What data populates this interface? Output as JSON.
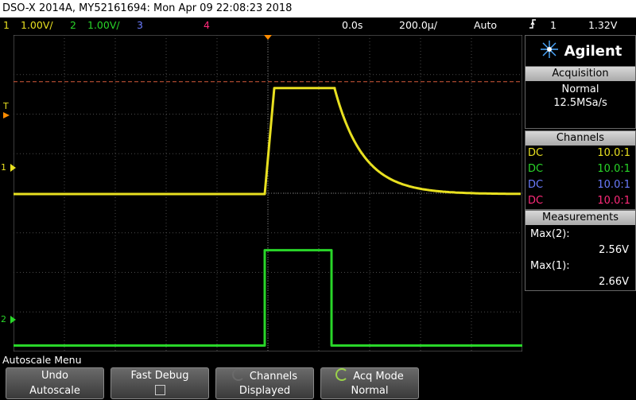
{
  "window": {
    "title": "DSO-X 2014A, MY52161694: Mon Apr 09 22:08:23 2018"
  },
  "status": {
    "ch1_num": "1",
    "ch1_scale": "1.00V/",
    "ch2_num": "2",
    "ch2_scale": "1.00V/",
    "ch3_num": "3",
    "ch4_num": "4",
    "time_delay": "0.0s",
    "time_scale": "200.0µ/",
    "trigger_mode": "Auto",
    "trigger_slope_glyph": "⌁",
    "trigger_source": "1",
    "trigger_level": "1.32V"
  },
  "colors": {
    "ch1": "#e8e020",
    "ch2": "#29d629",
    "ch3": "#6b7cff",
    "ch4": "#ff2a7a",
    "grid": "#4a4a4a",
    "trigger_line": "#d65a3a",
    "trigger_marker": "#ff8c00"
  },
  "brand": {
    "name": "Agilent",
    "logo_icon": "agilent-spark-icon"
  },
  "acquisition": {
    "title": "Acquisition",
    "mode": "Normal",
    "rate": "12.5MSa/s"
  },
  "channels": {
    "title": "Channels",
    "rows": [
      {
        "coupling": "DC",
        "probe": "10.0:1"
      },
      {
        "coupling": "DC",
        "probe": "10.0:1"
      },
      {
        "coupling": "DC",
        "probe": "10.0:1"
      },
      {
        "coupling": "DC",
        "probe": "10.0:1"
      }
    ]
  },
  "measurements": {
    "title": "Measurements",
    "items": [
      {
        "label": "Max(2):",
        "value": "2.56V"
      },
      {
        "label": "Max(1):",
        "value": "2.66V"
      }
    ]
  },
  "markers": {
    "trigger_t": "T",
    "ch1_ref": "1",
    "ch2_ref": "2"
  },
  "menu": {
    "title": "Autoscale Menu",
    "softkeys": [
      {
        "line1": "Undo",
        "line2": "Autoscale"
      },
      {
        "line1": "Fast Debug",
        "line2": ""
      },
      {
        "line1": "Channels",
        "line2": "Displayed"
      },
      {
        "line1": "Acq Mode",
        "line2": "Normal"
      }
    ]
  },
  "chart_data": {
    "type": "line",
    "x": [
      -0.00016,
      0.0,
      1e-05,
      1e-05,
      0.00042,
      0.00048,
      0.00065,
      0.0008,
      0.001,
      0.0012,
      0.00128
    ],
    "xlim": [
      -0.0016,
      0.0016
    ],
    "ylim": [
      -4,
      4
    ],
    "series": [
      {
        "name": "1",
        "x": [
          -0.0016,
          -2e-05,
          1e-05,
          4e-05,
          0.00042,
          0.00048,
          0.0006,
          0.0008,
          0.001,
          0.0012,
          0.0016
        ],
        "values": [
          -0.02,
          -0.02,
          1.5,
          2.66,
          2.66,
          2.2,
          1.2,
          0.5,
          0.15,
          0.04,
          0.0
        ]
      },
      {
        "name": "2",
        "x": [
          -0.0016,
          -2e-05,
          -2e-05,
          0.0004,
          0.0004,
          0.0016
        ],
        "values": [
          -3.85,
          -3.85,
          -1.44,
          -1.44,
          -3.85,
          -3.85
        ]
      }
    ]
  }
}
